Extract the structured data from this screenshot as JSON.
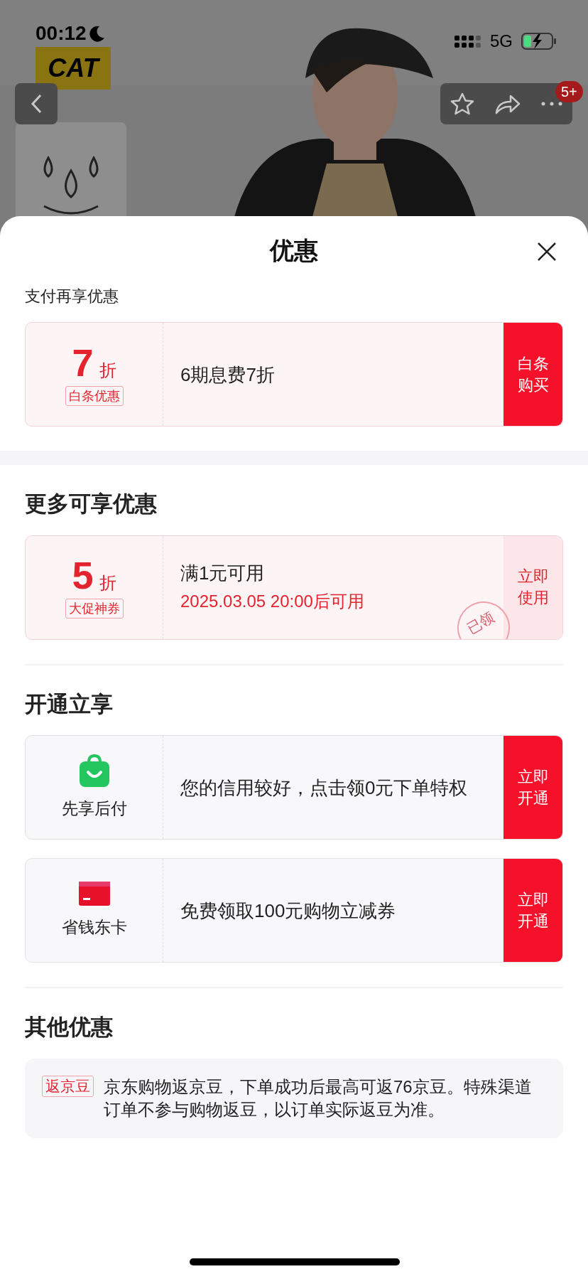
{
  "status_bar": {
    "time": "00:12",
    "network": "5G"
  },
  "header": {
    "logo": "CAT",
    "badge": "5+"
  },
  "sheet": {
    "title": "优惠",
    "sections": [
      {
        "kind": "subheading",
        "title": "支付再享优惠",
        "cards": [
          {
            "kind": "discount",
            "value": "7",
            "unit": "折",
            "tag": "白条优惠",
            "text": "6期息费7折",
            "button": "白条购买"
          }
        ]
      },
      {
        "kind": "heading",
        "title": "更多可享优惠",
        "cards": [
          {
            "kind": "discount",
            "value": "5",
            "unit": "折",
            "tag": "大促神券",
            "text": "满1元可用",
            "subtext": "2025.03.05 20:00后可用",
            "button": "立即使用",
            "stamp": "已领"
          }
        ]
      },
      {
        "kind": "heading",
        "title": "开通立享",
        "cards": [
          {
            "kind": "credit",
            "label": "先享后付",
            "text": "您的信用较好，点击领0元下单特权",
            "button": "立即开通"
          },
          {
            "kind": "membership",
            "label": "省钱东卡",
            "text": "免费领取100元购物立减券",
            "button": "立即开通"
          }
        ]
      },
      {
        "kind": "heading",
        "title": "其他优惠",
        "note": {
          "tag": "返京豆",
          "text": "京东购物返京豆，下单成功后最高可返76京豆。特殊渠道订单不参与购物返豆，以订单实际返豆为准。"
        }
      }
    ]
  }
}
